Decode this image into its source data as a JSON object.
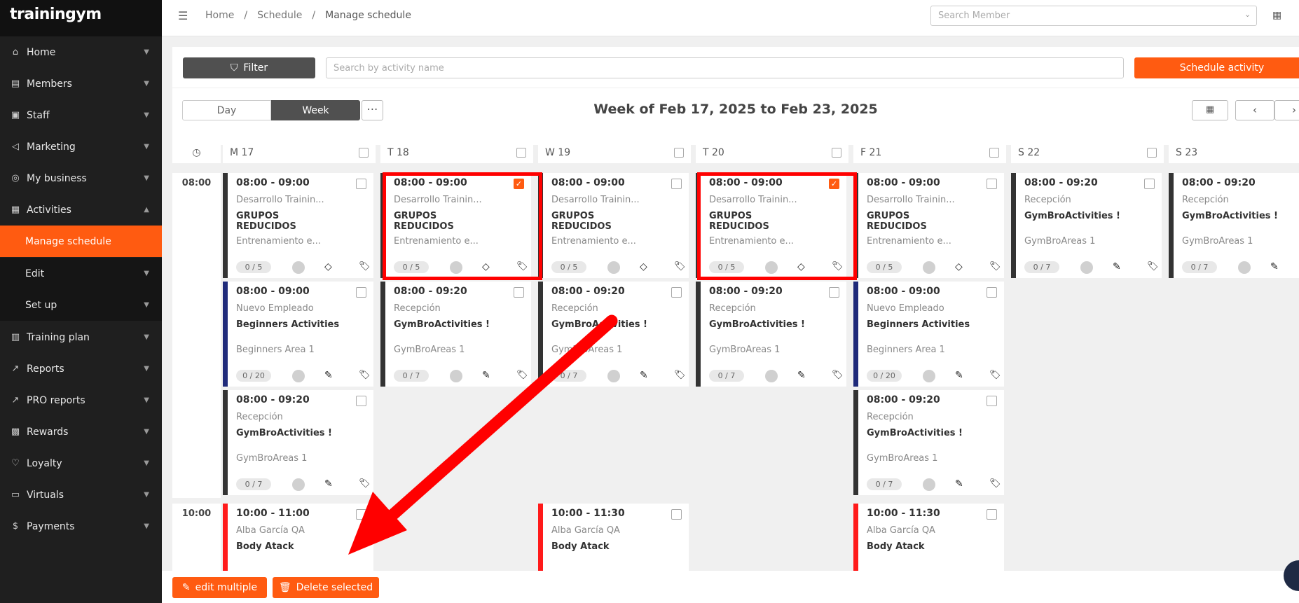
{
  "app": {
    "logo": "trainingym"
  },
  "sidebar": {
    "items": [
      {
        "label": "Home",
        "icon": "⌂"
      },
      {
        "label": "Members",
        "icon": "▤"
      },
      {
        "label": "Staff",
        "icon": "▣"
      },
      {
        "label": "Marketing",
        "icon": "◁"
      },
      {
        "label": "My business",
        "icon": "◎"
      },
      {
        "label": "Activities",
        "icon": "▦"
      },
      {
        "label": "Manage schedule",
        "icon": ""
      },
      {
        "label": "Edit",
        "icon": ""
      },
      {
        "label": "Set up",
        "icon": ""
      },
      {
        "label": "Training plan",
        "icon": "▥"
      },
      {
        "label": "Reports",
        "icon": "↗"
      },
      {
        "label": "PRO reports",
        "icon": "↗"
      },
      {
        "label": "Rewards",
        "icon": "▩"
      },
      {
        "label": "Loyalty",
        "icon": "♡"
      },
      {
        "label": "Virtuals",
        "icon": "▭"
      },
      {
        "label": "Payments",
        "icon": "$"
      }
    ]
  },
  "breadcrumb": {
    "home": "Home",
    "sep": "/",
    "schedule": "Schedule",
    "current": "Manage schedule"
  },
  "header": {
    "member_search_placeholder": "Search Member"
  },
  "toolbar": {
    "filter_label": "Filter",
    "activity_search_placeholder": "Search by activity name",
    "schedule_activity_label": "Schedule activity",
    "view_day": "Day",
    "view_week": "Week",
    "more": "⋯",
    "week_title": "Week of Feb 17, 2025 to Feb 23, 2025",
    "prev": "‹",
    "next": "›"
  },
  "days": [
    "M 17",
    "T 18",
    "W 19",
    "T 20",
    "F 21",
    "S 22",
    "S 23"
  ],
  "time_slots": [
    "08:00",
    "10:00"
  ],
  "cards": [
    {
      "time": "08:00 - 09:00",
      "instructor": "Desarrollo Trainin...",
      "name": "GRUPOS REDUCIDOS",
      "area": "Entrenamiento e...",
      "capacity": "0 / 5",
      "icon1": "◇",
      "checked": false
    },
    {
      "time": "08:00 - 09:00",
      "instructor": "Desarrollo Trainin...",
      "name": "GRUPOS REDUCIDOS",
      "area": "Entrenamiento e...",
      "capacity": "0 / 5",
      "icon1": "◇",
      "checked": true
    },
    {
      "time": "08:00 - 09:00",
      "instructor": "Desarrollo Trainin...",
      "name": "GRUPOS REDUCIDOS",
      "area": "Entrenamiento e...",
      "capacity": "0 / 5",
      "icon1": "◇",
      "checked": false
    },
    {
      "time": "08:00 - 09:00",
      "instructor": "Desarrollo Trainin...",
      "name": "GRUPOS REDUCIDOS",
      "area": "Entrenamiento e...",
      "capacity": "0 / 5",
      "icon1": "◇",
      "checked": true
    },
    {
      "time": "08:00 - 09:00",
      "instructor": "Desarrollo Trainin...",
      "name": "GRUPOS REDUCIDOS",
      "area": "Entrenamiento e...",
      "capacity": "0 / 5",
      "icon1": "◇",
      "checked": false
    },
    {
      "time": "08:00 - 09:20",
      "instructor": "Recepción",
      "name": "GymBroActivities !",
      "area": "GymBroAreas 1",
      "capacity": "0 / 7",
      "icon1": "✎",
      "checked": false
    },
    {
      "time": "08:00 - 09:20",
      "instructor": "Recepción",
      "name": "GymBroActivities !",
      "area": "GymBroAreas 1",
      "capacity": "0 / 7",
      "icon1": "✎",
      "checked": false
    },
    {
      "time": "08:00 - 09:00",
      "instructor": "Nuevo Empleado",
      "name": "Beginners Activities",
      "area": "Beginners Area 1",
      "capacity": "0 / 20",
      "icon1": "✎",
      "checked": false
    },
    {
      "time": "08:00 - 09:20",
      "instructor": "Recepción",
      "name": "GymBroActivities !",
      "area": "GymBroAreas 1",
      "capacity": "0 / 7",
      "icon1": "✎",
      "checked": false
    },
    {
      "time": "08:00 - 09:20",
      "instructor": "Recepción",
      "name": "GymBroActivities !",
      "area": "GymBroAreas 1",
      "capacity": "0 / 7",
      "icon1": "✎",
      "checked": false
    },
    {
      "time": "08:00 - 09:20",
      "instructor": "Recepción",
      "name": "GymBroActivities !",
      "area": "GymBroAreas 1",
      "capacity": "0 / 7",
      "icon1": "✎",
      "checked": false
    },
    {
      "time": "08:00 - 09:00",
      "instructor": "Nuevo Empleado",
      "name": "Beginners Activities",
      "area": "Beginners Area 1",
      "capacity": "0 / 20",
      "icon1": "✎",
      "checked": false
    },
    {
      "time": "08:00 - 09:20",
      "instructor": "Recepción",
      "name": "GymBroActivities !",
      "area": "GymBroAreas 1",
      "capacity": "0 / 7",
      "icon1": "✎",
      "checked": false
    },
    {
      "time": "08:00 - 09:20",
      "instructor": "Recepción",
      "name": "GymBroActivities !",
      "area": "GymBroAreas 1",
      "capacity": "0 / 7",
      "icon1": "✎",
      "checked": false
    },
    {
      "time": "10:00 - 11:00",
      "instructor": "Alba García QA",
      "name": "Body Atack",
      "area": "",
      "capacity": "",
      "icon1": "",
      "checked": false
    },
    {
      "time": "10:00 - 11:30",
      "instructor": "Alba García QA",
      "name": "Body Atack",
      "area": "",
      "capacity": "",
      "icon1": "",
      "checked": false
    },
    {
      "time": "10:00 - 11:30",
      "instructor": "Alba García QA",
      "name": "Body Atack",
      "area": "",
      "capacity": "",
      "icon1": "",
      "checked": false
    }
  ],
  "bottom": {
    "edit_multiple": "edit multiple",
    "delete_selected": "Delete selected"
  },
  "colors": {
    "accent": "#ff5b11",
    "highlight": "#ff0000",
    "blue": "#1f2a7a",
    "dark": "#333333"
  }
}
